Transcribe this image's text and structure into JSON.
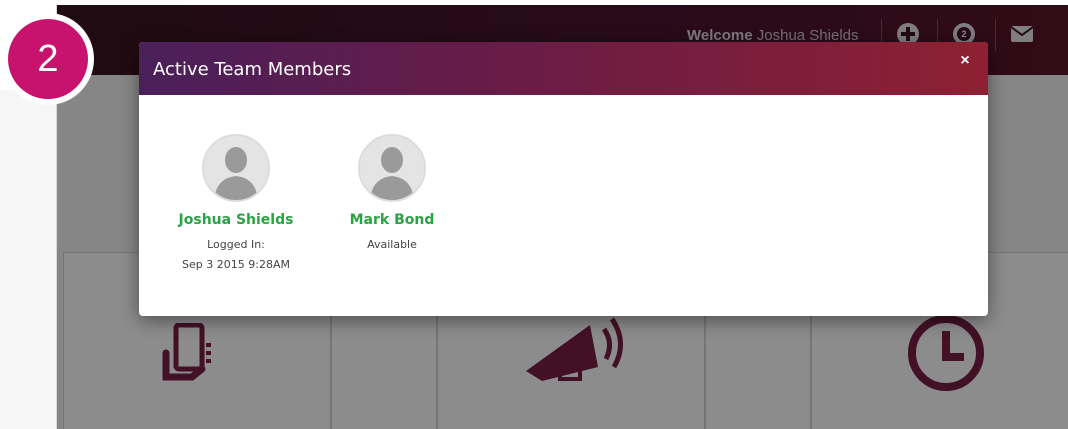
{
  "step_badge": {
    "number": "2",
    "color": "#c8136e"
  },
  "topbar": {
    "welcome_prefix": "Welcome",
    "user_name": "Joshua Shields",
    "icons": [
      "plus-circle-icon",
      "notifications-icon",
      "envelope-icon"
    ],
    "notification_count": "2"
  },
  "background_tiles": {
    "icons": [
      "phone-hand-icon",
      "megaphone-icon",
      "clock-icon"
    ],
    "icon_color": "#7a1f45"
  },
  "modal": {
    "title": "Active Team Members",
    "close_label": "×",
    "members": [
      {
        "name": "Joshua Shields",
        "status_line1": "Logged In:",
        "status_line2": "Sep 3 2015 9:28AM"
      },
      {
        "name": "Mark Bond",
        "status_line1": "Available",
        "status_line2": ""
      }
    ]
  },
  "colors": {
    "header_gradient_start": "#4a1f5a",
    "header_gradient_end": "#8e2032",
    "member_name": "#2aa344"
  }
}
